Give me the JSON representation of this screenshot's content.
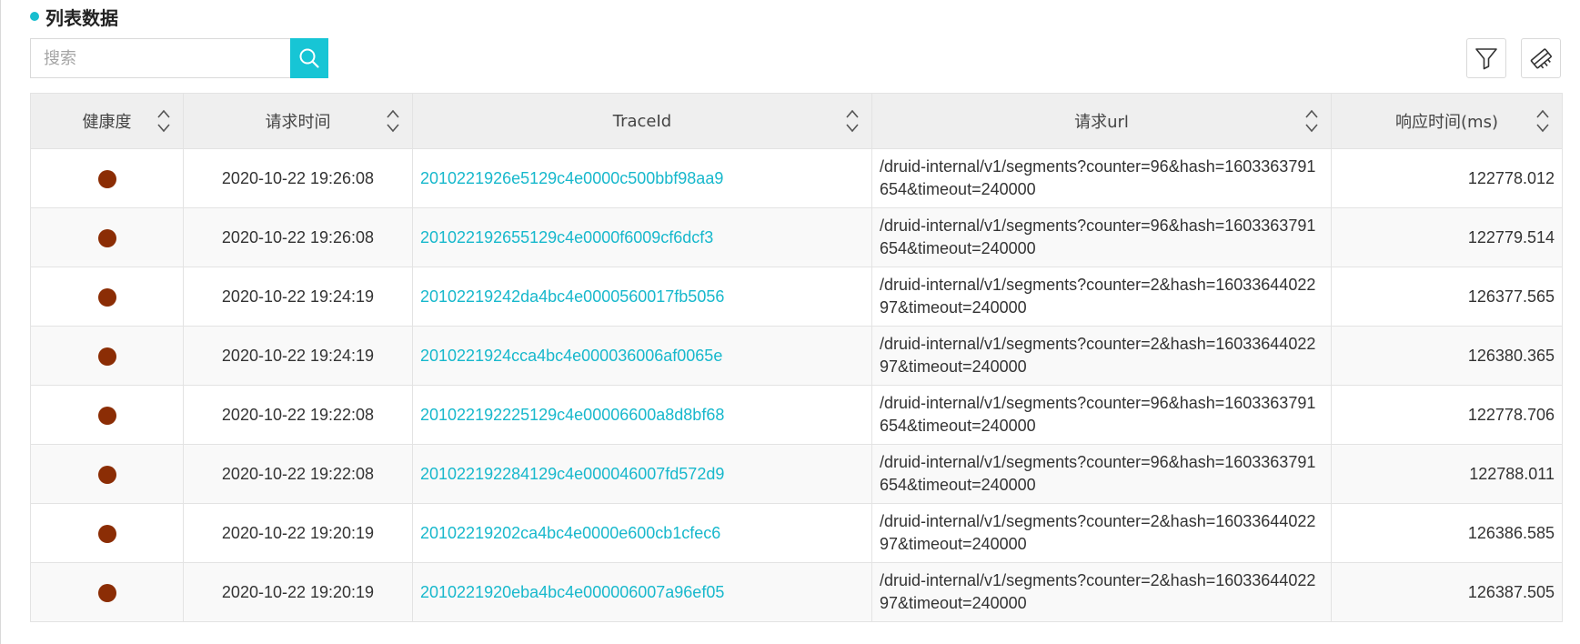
{
  "section": {
    "title": "列表数据"
  },
  "search": {
    "placeholder": "搜索",
    "value": ""
  },
  "toolbar": {
    "filter_icon": "filter-icon",
    "clear_icon": "clear-filter-icon"
  },
  "colors": {
    "accent": "#17c5d5",
    "link": "#17b8cc",
    "health_status": "#8b2d05"
  },
  "table": {
    "columns": [
      "健康度",
      "请求时间",
      "TraceId",
      "请求url",
      "响应时间(ms)"
    ],
    "rows": [
      {
        "health": "red",
        "time": "2020-10-22 19:26:08",
        "trace_id": "2010221926e5129c4e0000c500bbf98aa9",
        "url": "/druid-internal/v1/segments?counter=96&hash=1603363791654&timeout=240000",
        "response_time": "122778.012"
      },
      {
        "health": "red",
        "time": "2020-10-22 19:26:08",
        "trace_id": "201022192655129c4e0000f6009cf6dcf3",
        "url": "/druid-internal/v1/segments?counter=96&hash=1603363791654&timeout=240000",
        "response_time": "122779.514"
      },
      {
        "health": "red",
        "time": "2020-10-22 19:24:19",
        "trace_id": "20102219242da4bc4e0000560017fb5056",
        "url": "/druid-internal/v1/segments?counter=2&hash=1603364402297&timeout=240000",
        "response_time": "126377.565"
      },
      {
        "health": "red",
        "time": "2020-10-22 19:24:19",
        "trace_id": "2010221924cca4bc4e000036006af0065e",
        "url": "/druid-internal/v1/segments?counter=2&hash=1603364402297&timeout=240000",
        "response_time": "126380.365"
      },
      {
        "health": "red",
        "time": "2020-10-22 19:22:08",
        "trace_id": "201022192225129c4e00006600a8d8bf68",
        "url": "/druid-internal/v1/segments?counter=96&hash=1603363791654&timeout=240000",
        "response_time": "122778.706"
      },
      {
        "health": "red",
        "time": "2020-10-22 19:22:08",
        "trace_id": "201022192284129c4e000046007fd572d9",
        "url": "/druid-internal/v1/segments?counter=96&hash=1603363791654&timeout=240000",
        "response_time": "122788.011"
      },
      {
        "health": "red",
        "time": "2020-10-22 19:20:19",
        "trace_id": "20102219202ca4bc4e0000e600cb1cfec6",
        "url": "/druid-internal/v1/segments?counter=2&hash=1603364402297&timeout=240000",
        "response_time": "126386.585"
      },
      {
        "health": "red",
        "time": "2020-10-22 19:20:19",
        "trace_id": "2010221920eba4bc4e000006007a96ef05",
        "url": "/druid-internal/v1/segments?counter=2&hash=1603364402297&timeout=240000",
        "response_time": "126387.505"
      }
    ]
  }
}
